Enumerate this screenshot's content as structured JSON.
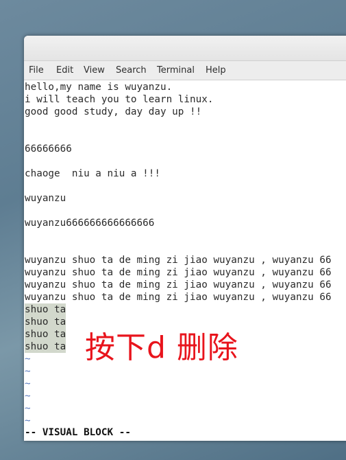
{
  "menu": [
    "File",
    "Edit",
    "View",
    "Search",
    "Terminal",
    "Help"
  ],
  "lines": [
    {
      "text": "hello,my name is wuyanzu."
    },
    {
      "text": "i will teach you to learn linux."
    },
    {
      "text": "good good study, day day up !!"
    },
    {
      "text": ""
    },
    {
      "text": ""
    },
    {
      "text": "66666666"
    },
    {
      "text": ""
    },
    {
      "text": "chaoge  niu a niu a !!!"
    },
    {
      "text": ""
    },
    {
      "text": "wuyanzu"
    },
    {
      "text": ""
    },
    {
      "text": "wuyanzu666666666666666"
    },
    {
      "text": ""
    },
    {
      "text": ""
    },
    {
      "text": "wuyanzu shuo ta de ming zi jiao wuyanzu , wuyanzu 66"
    },
    {
      "text": "wuyanzu shuo ta de ming zi jiao wuyanzu , wuyanzu 66"
    },
    {
      "text": "wuyanzu shuo ta de ming zi jiao wuyanzu , wuyanzu 66"
    },
    {
      "text": "wuyanzu shuo ta de ming zi jiao wuyanzu , wuyanzu 66"
    },
    {
      "text": "shuo ta",
      "selected": true
    },
    {
      "text": "shuo ta",
      "selected": true
    },
    {
      "text": "shuo ta",
      "selected": true
    },
    {
      "text": "shuo ta",
      "selected": true
    },
    {
      "text": "~",
      "tilde": true
    },
    {
      "text": "~",
      "tilde": true
    },
    {
      "text": "~",
      "tilde": true
    },
    {
      "text": "~",
      "tilde": true
    },
    {
      "text": "~",
      "tilde": true
    },
    {
      "text": "~",
      "tilde": true
    }
  ],
  "status_line": "-- VISUAL BLOCK --",
  "annotation": "按下d 删除",
  "colors": {
    "selection": "#d2d8cc",
    "annotation": "#e8141c",
    "tilde": "#5a7bbf"
  }
}
